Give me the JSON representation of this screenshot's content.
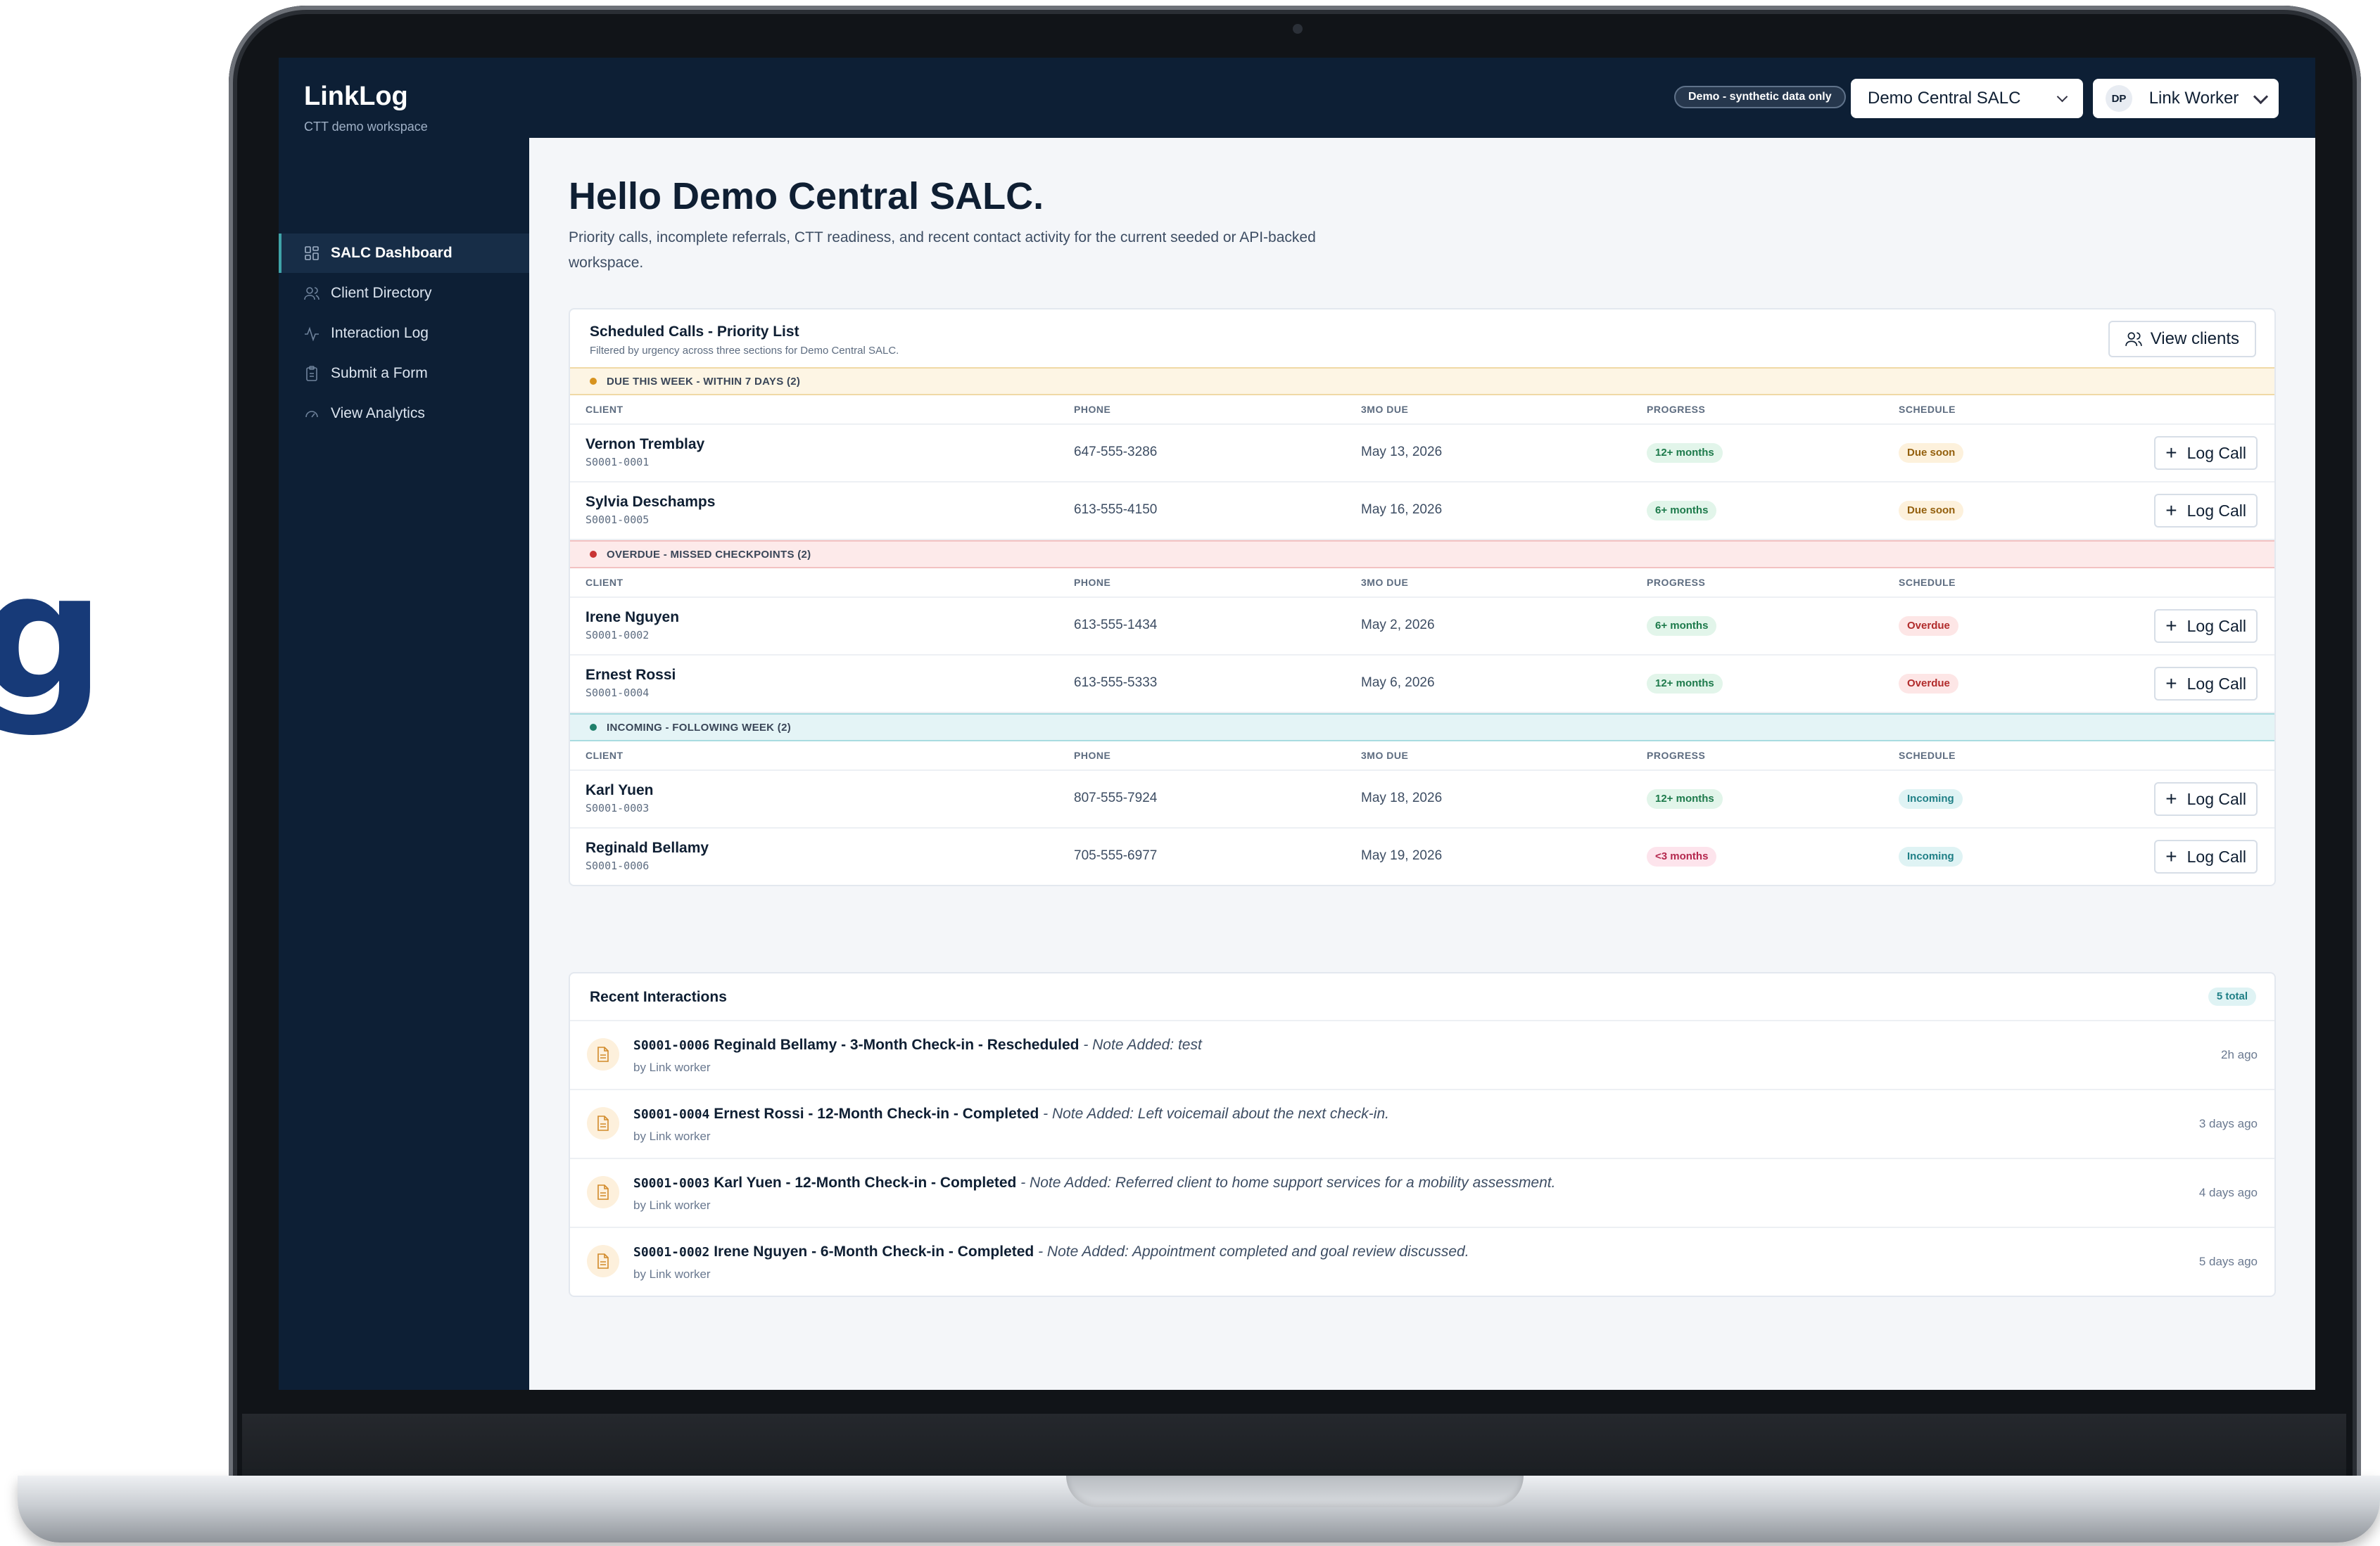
{
  "backdrop_text": "g",
  "app": {
    "name": "LinkLog",
    "workspace": "CTT demo workspace"
  },
  "topbar": {
    "demo_badge": "Demo - synthetic data only",
    "workspace_select": "Demo Central SALC",
    "user": {
      "initials": "DP",
      "name": "Link Worker"
    }
  },
  "sidebar": {
    "items": [
      {
        "label": "SALC Dashboard",
        "icon": "dashboard-icon",
        "active": true
      },
      {
        "label": "Client Directory",
        "icon": "users-icon",
        "active": false
      },
      {
        "label": "Interaction Log",
        "icon": "activity-icon",
        "active": false
      },
      {
        "label": "Submit a Form",
        "icon": "clipboard-icon",
        "active": false
      },
      {
        "label": "View Analytics",
        "icon": "gauge-icon",
        "active": false
      }
    ]
  },
  "page": {
    "title": "Hello Demo Central SALC.",
    "intro": "Priority calls, incomplete referrals, CTT readiness, and recent contact activity for the current seeded or API-backed workspace."
  },
  "scheduled": {
    "title": "Scheduled Calls - Priority List",
    "subtitle": "Filtered by urgency across three sections for Demo Central SALC.",
    "view_clients": "View clients",
    "columns": {
      "client": "CLIENT",
      "phone": "PHONE",
      "due": "3MO DUE",
      "progress": "PROGRESS",
      "schedule": "SCHEDULE"
    },
    "log_call": "Log Call",
    "sections": [
      {
        "label": "DUE THIS WEEK - WITHIN 7 DAYS (2)",
        "tone": "warn",
        "rows": [
          {
            "name": "Vernon Tremblay",
            "id": "S0001-0001",
            "phone": "647-555-3286",
            "due": "May 13, 2026",
            "progress": "12+ months",
            "progress_tone": "green",
            "schedule": "Due soon",
            "schedule_tone": "amber"
          },
          {
            "name": "Sylvia Deschamps",
            "id": "S0001-0005",
            "phone": "613-555-4150",
            "due": "May 16, 2026",
            "progress": "6+ months",
            "progress_tone": "green",
            "schedule": "Due soon",
            "schedule_tone": "amber"
          }
        ]
      },
      {
        "label": "OVERDUE - MISSED CHECKPOINTS (2)",
        "tone": "danger",
        "rows": [
          {
            "name": "Irene Nguyen",
            "id": "S0001-0002",
            "phone": "613-555-1434",
            "due": "May 2, 2026",
            "progress": "6+ months",
            "progress_tone": "green",
            "schedule": "Overdue",
            "schedule_tone": "red"
          },
          {
            "name": "Ernest Rossi",
            "id": "S0001-0004",
            "phone": "613-555-5333",
            "due": "May 6, 2026",
            "progress": "12+ months",
            "progress_tone": "green",
            "schedule": "Overdue",
            "schedule_tone": "red"
          }
        ]
      },
      {
        "label": "INCOMING - FOLLOWING WEEK (2)",
        "tone": "info",
        "rows": [
          {
            "name": "Karl Yuen",
            "id": "S0001-0003",
            "phone": "807-555-7924",
            "due": "May 18, 2026",
            "progress": "12+ months",
            "progress_tone": "green",
            "schedule": "Incoming",
            "schedule_tone": "teal"
          },
          {
            "name": "Reginald Bellamy",
            "id": "S0001-0006",
            "phone": "705-555-6977",
            "due": "May 19, 2026",
            "progress": "<3 months",
            "progress_tone": "pink",
            "schedule": "Incoming",
            "schedule_tone": "teal"
          }
        ]
      }
    ]
  },
  "recent": {
    "title": "Recent Interactions",
    "total": "5 total",
    "items": [
      {
        "code": "S0001-0006",
        "title": "Reginald Bellamy - 3-Month Check-in - Rescheduled",
        "note": "- Note Added: test",
        "by": "by Link worker",
        "when": "2h ago"
      },
      {
        "code": "S0001-0004",
        "title": "Ernest Rossi - 12-Month Check-in - Completed",
        "note": "- Note Added: Left voicemail about the next check-in.",
        "by": "by Link worker",
        "when": "3 days ago"
      },
      {
        "code": "S0001-0003",
        "title": "Karl Yuen - 12-Month Check-in - Completed",
        "note": "- Note Added: Referred client to home support services for a mobility assessment.",
        "by": "by Link worker",
        "when": "4 days ago"
      },
      {
        "code": "S0001-0002",
        "title": "Irene Nguyen - 6-Month Check-in - Completed",
        "note": "- Note Added: Appointment completed and goal review discussed.",
        "by": "by Link worker",
        "when": "5 days ago"
      }
    ]
  },
  "colors": {
    "navy": "#0d1f35",
    "accent_teal": "#3fa3a8",
    "warn_band": "#fdf5e4",
    "danger_band": "#fdeaea",
    "info_band": "#e4f4f6"
  }
}
